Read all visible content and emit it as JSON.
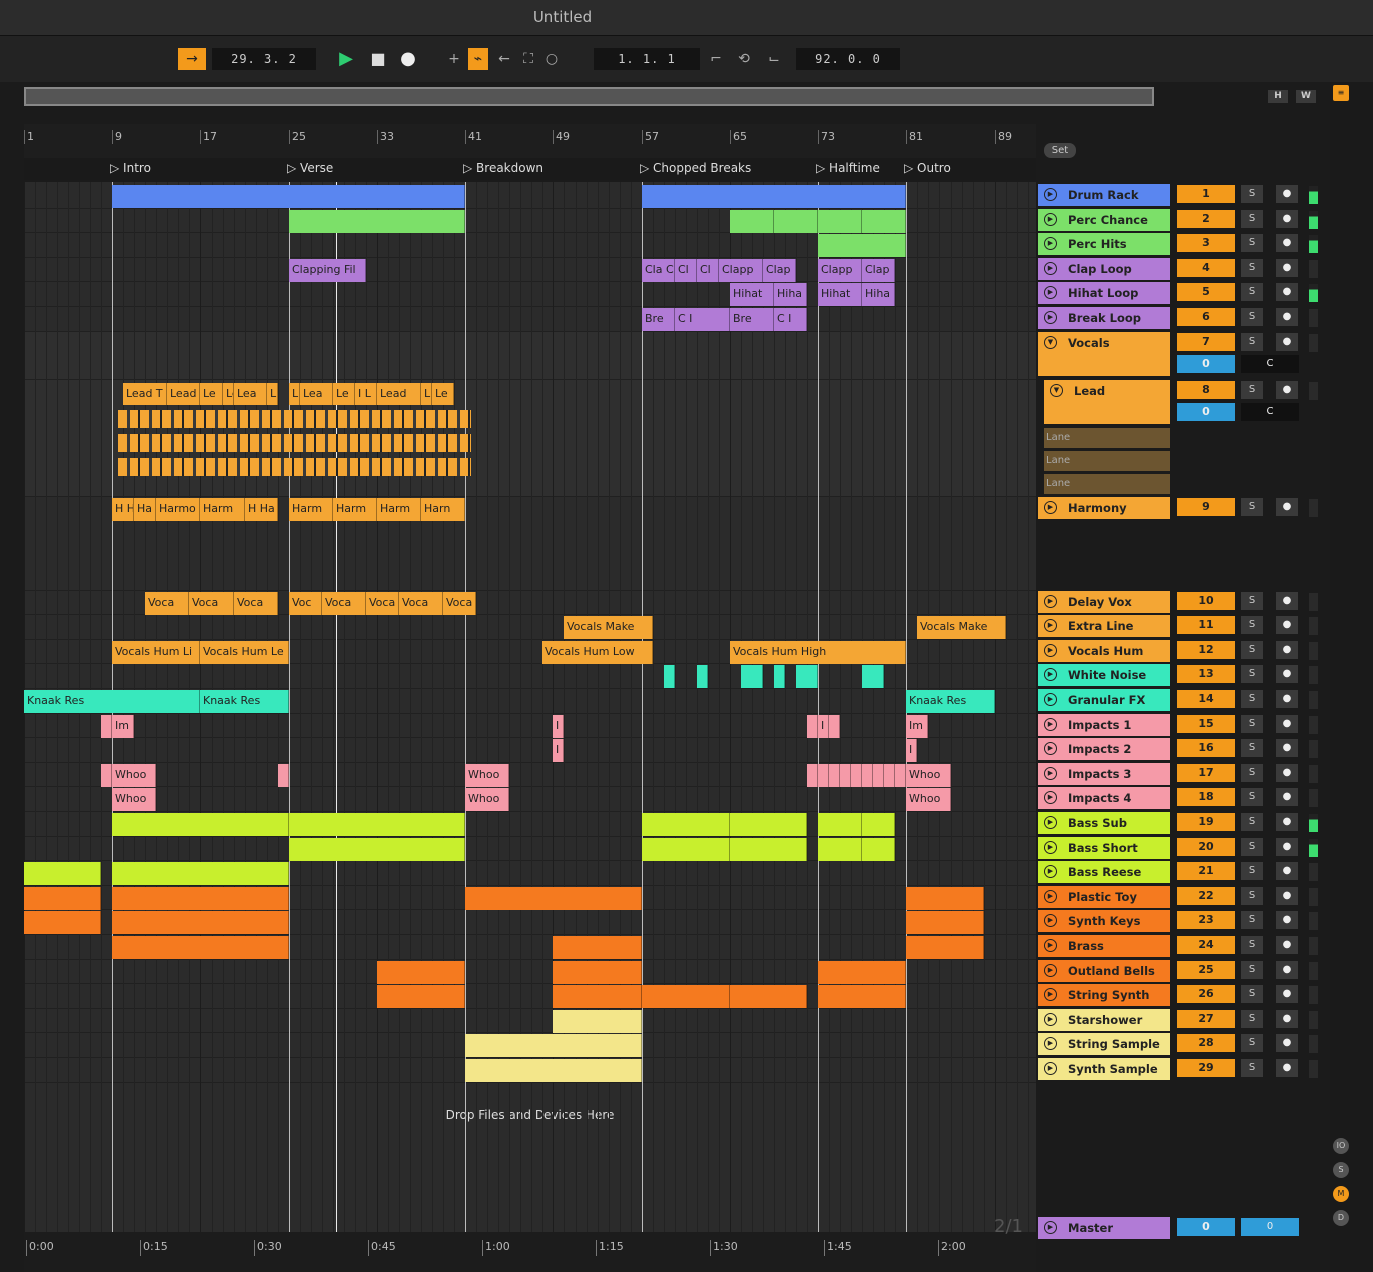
{
  "window": {
    "title": "Untitled"
  },
  "transport": {
    "position": "29.  3.  2",
    "loop_start": "1.  1.  1",
    "loop_length": "92.  0.  0"
  },
  "overview": {
    "h_label": "H",
    "w_label": "W"
  },
  "ruler": {
    "bars": [
      "1",
      "9",
      "17",
      "25",
      "33",
      "41",
      "49",
      "57",
      "65",
      "73",
      "81",
      "89"
    ]
  },
  "locators": [
    "Intro",
    "Verse",
    "Breakdown",
    "Chopped Breaks",
    "Halftime",
    "Outro"
  ],
  "set_label": "Set",
  "drop_hint": "Drop Files and Devices Here",
  "page_counter": "2/1",
  "time_ruler": [
    "0:00",
    "0:15",
    "0:30",
    "0:45",
    "1:00",
    "1:15",
    "1:30",
    "1:45",
    "2:00"
  ],
  "colors": {
    "blue": "#5a86f0",
    "green": "#7ce069",
    "purple": "#b17bd6",
    "orange": "#f4a634",
    "teal": "#38e8bd",
    "pink": "#f59aa8",
    "lime": "#c8ef2d",
    "deeporange": "#f57a1f",
    "yellow": "#f3e68a",
    "cyan": "#44d9f0"
  },
  "tracks": [
    {
      "name": "Drum Rack",
      "num": "1",
      "solo": "S",
      "color": "#5a86f0"
    },
    {
      "name": "Perc Chance",
      "num": "2",
      "solo": "S",
      "color": "#7ce069"
    },
    {
      "name": "Perc Hits",
      "num": "3",
      "solo": "S",
      "color": "#7ce069"
    },
    {
      "name": "Clap Loop",
      "num": "4",
      "solo": "S",
      "color": "#b17bd6"
    },
    {
      "name": "Hihat Loop",
      "num": "5",
      "solo": "S",
      "color": "#b17bd6"
    },
    {
      "name": "Break Loop",
      "num": "6",
      "solo": "S",
      "color": "#b17bd6"
    },
    {
      "name": "Vocals",
      "num": "7",
      "solo": "S",
      "color": "#f4a634",
      "group": true,
      "vol": "0",
      "pan": "C"
    },
    {
      "name": "Lead",
      "num": "8",
      "solo": "S",
      "color": "#f4a634",
      "group": true,
      "vol": "0",
      "pan": "C",
      "lanes": [
        "Lane",
        "Lane",
        "Lane"
      ]
    },
    {
      "name": "Harmony",
      "num": "9",
      "solo": "S",
      "color": "#f4a634"
    },
    {
      "name": "Delay Vox",
      "num": "10",
      "solo": "S",
      "color": "#f4a634"
    },
    {
      "name": "Extra Line",
      "num": "11",
      "solo": "S",
      "color": "#f4a634"
    },
    {
      "name": "Vocals Hum",
      "num": "12",
      "solo": "S",
      "color": "#f4a634"
    },
    {
      "name": "White Noise",
      "num": "13",
      "solo": "S",
      "color": "#38e8bd"
    },
    {
      "name": "Granular FX",
      "num": "14",
      "solo": "S",
      "color": "#38e8bd"
    },
    {
      "name": "Impacts 1",
      "num": "15",
      "solo": "S",
      "color": "#f59aa8"
    },
    {
      "name": "Impacts 2",
      "num": "16",
      "solo": "S",
      "color": "#f59aa8"
    },
    {
      "name": "Impacts 3",
      "num": "17",
      "solo": "S",
      "color": "#f59aa8"
    },
    {
      "name": "Impacts 4",
      "num": "18",
      "solo": "S",
      "color": "#f59aa8"
    },
    {
      "name": "Bass Sub",
      "num": "19",
      "solo": "S",
      "color": "#c8ef2d"
    },
    {
      "name": "Bass Short",
      "num": "20",
      "solo": "S",
      "color": "#c8ef2d"
    },
    {
      "name": "Bass Reese",
      "num": "21",
      "solo": "S",
      "color": "#c8ef2d"
    },
    {
      "name": "Plastic Toy",
      "num": "22",
      "solo": "S",
      "color": "#f57a1f"
    },
    {
      "name": "Synth Keys",
      "num": "23",
      "solo": "S",
      "color": "#f57a1f"
    },
    {
      "name": "Brass",
      "num": "24",
      "solo": "S",
      "color": "#f57a1f"
    },
    {
      "name": "Outland Bells",
      "num": "25",
      "solo": "S",
      "color": "#f57a1f"
    },
    {
      "name": "String Synth",
      "num": "26",
      "solo": "S",
      "color": "#f57a1f"
    },
    {
      "name": "Starshower Pad",
      "num": "27",
      "solo": "S",
      "color": "#f3e68a"
    },
    {
      "name": "String Sample",
      "num": "28",
      "solo": "S",
      "color": "#f3e68a"
    },
    {
      "name": "Synth Sample",
      "num": "29",
      "solo": "S",
      "color": "#f3e68a"
    }
  ],
  "master": {
    "name": "Master",
    "vol": "0",
    "pan": "0",
    "color": "#b17bd6"
  },
  "clips": [
    {
      "row": 0,
      "bars": [
        [
          9,
          41,
          ""
        ],
        [
          57,
          81,
          ""
        ]
      ],
      "color": "#5a86f0"
    },
    {
      "row": 1,
      "bars": [
        [
          25,
          41,
          ""
        ],
        [
          65,
          69,
          ""
        ],
        [
          69,
          73,
          ""
        ],
        [
          73,
          77,
          ""
        ],
        [
          77,
          81,
          ""
        ]
      ],
      "color": "#7ce069"
    },
    {
      "row": 2,
      "bars": [
        [
          73,
          81,
          ""
        ]
      ],
      "color": "#7ce069"
    },
    {
      "row": 3,
      "bars": [
        [
          25,
          32,
          "Clapping Fil"
        ],
        [
          57,
          60,
          "Cla C"
        ],
        [
          60,
          62,
          "Cl"
        ],
        [
          62,
          64,
          "Cl"
        ],
        [
          64,
          68,
          "Clapp"
        ],
        [
          68,
          71,
          "Clap"
        ],
        [
          73,
          77,
          "Clapp"
        ],
        [
          77,
          80,
          "Clap"
        ]
      ],
      "color": "#b17bd6"
    },
    {
      "row": 4,
      "bars": [
        [
          65,
          69,
          "Hihat"
        ],
        [
          69,
          72,
          "Hiha"
        ],
        [
          73,
          77,
          "Hihat"
        ],
        [
          77,
          80,
          "Hiha"
        ]
      ],
      "color": "#b17bd6"
    },
    {
      "row": 5,
      "bars": [
        [
          57,
          60,
          "Bre"
        ],
        [
          60,
          65,
          "C I"
        ],
        [
          65,
          69,
          "Bre"
        ],
        [
          69,
          72,
          "C I"
        ]
      ],
      "color": "#b17bd6"
    },
    {
      "row": 7,
      "bars": [
        [
          10,
          14,
          "Lead T"
        ],
        [
          14,
          17,
          "Lead T"
        ],
        [
          17,
          19,
          "Le"
        ],
        [
          19,
          20,
          "Le"
        ],
        [
          20,
          23,
          "Lea"
        ],
        [
          23,
          24,
          "L"
        ],
        [
          25,
          26,
          "L"
        ],
        [
          26,
          29,
          "Lea"
        ],
        [
          29,
          31,
          "Le"
        ],
        [
          31,
          33,
          "I L"
        ],
        [
          33,
          37,
          "Lead"
        ],
        [
          37,
          38,
          "L"
        ],
        [
          38,
          40,
          "Le"
        ]
      ],
      "color": "#f4a634"
    },
    {
      "row": 8,
      "bars": [
        [
          9,
          11,
          "H H"
        ],
        [
          11,
          13,
          "Ha"
        ],
        [
          13,
          17,
          "Harmo"
        ],
        [
          17,
          21,
          "Harm"
        ],
        [
          21,
          24,
          "H Ha"
        ],
        [
          25,
          29,
          "Harm"
        ],
        [
          29,
          33,
          "Harm"
        ],
        [
          33,
          37,
          "Harm"
        ],
        [
          37,
          41,
          "Harn"
        ]
      ],
      "color": "#f4a634"
    },
    {
      "row": 9,
      "bars": [
        [
          12,
          16,
          "Voca"
        ],
        [
          16,
          20,
          "Voca"
        ],
        [
          20,
          24,
          "Voca"
        ],
        [
          25,
          28,
          "Voc"
        ],
        [
          28,
          32,
          "Voca"
        ],
        [
          32,
          35,
          "Voca"
        ],
        [
          35,
          39,
          "Voca"
        ],
        [
          39,
          42,
          "Voca"
        ]
      ],
      "color": "#f4a634"
    },
    {
      "row": 10,
      "bars": [
        [
          50,
          58,
          "Vocals Make"
        ],
        [
          82,
          90,
          "Vocals Make"
        ]
      ],
      "color": "#f4a634"
    },
    {
      "row": 11,
      "bars": [
        [
          9,
          17,
          "Vocals Hum Li"
        ],
        [
          17,
          25,
          "Vocals Hum Le"
        ],
        [
          48,
          58,
          "Vocals Hum Low"
        ],
        [
          65,
          81,
          "Vocals Hum High"
        ]
      ],
      "color": "#f4a634"
    },
    {
      "row": 12,
      "bars": [
        [
          59,
          60,
          ""
        ],
        [
          62,
          63,
          ""
        ],
        [
          66,
          68,
          ""
        ],
        [
          69,
          70,
          ""
        ],
        [
          71,
          73,
          ""
        ],
        [
          77,
          79,
          ""
        ]
      ],
      "color": "#38e8bd"
    },
    {
      "row": 13,
      "bars": [
        [
          1,
          17,
          "Knaak Res"
        ],
        [
          17,
          25,
          "Knaak Res"
        ],
        [
          81,
          89,
          "Knaak Res"
        ]
      ],
      "color": "#38e8bd"
    },
    {
      "row": 14,
      "bars": [
        [
          8,
          9,
          ""
        ],
        [
          9,
          11,
          "Im"
        ],
        [
          49,
          50,
          "I"
        ],
        [
          72,
          73,
          ""
        ],
        [
          73,
          74,
          "I"
        ],
        [
          74,
          75,
          ""
        ],
        [
          81,
          83,
          "Im"
        ]
      ],
      "color": "#f59aa8"
    },
    {
      "row": 15,
      "bars": [
        [
          49,
          50,
          "I"
        ],
        [
          81,
          82,
          "I"
        ]
      ],
      "color": "#f59aa8"
    },
    {
      "row": 16,
      "bars": [
        [
          8,
          9,
          ""
        ],
        [
          9,
          13,
          "Whoo"
        ],
        [
          24,
          25,
          ""
        ],
        [
          41,
          45,
          "Whoo"
        ],
        [
          72,
          73,
          ""
        ],
        [
          73,
          74,
          ""
        ],
        [
          74,
          75,
          ""
        ],
        [
          75,
          76,
          ""
        ],
        [
          76,
          77,
          ""
        ],
        [
          77,
          78,
          ""
        ],
        [
          78,
          79,
          ""
        ],
        [
          79,
          80,
          ""
        ],
        [
          80,
          81,
          ""
        ],
        [
          81,
          85,
          "Whoo"
        ]
      ],
      "color": "#f59aa8"
    },
    {
      "row": 17,
      "bars": [
        [
          9,
          13,
          "Whoo"
        ],
        [
          41,
          45,
          "Whoo"
        ],
        [
          81,
          85,
          "Whoo"
        ]
      ],
      "color": "#f59aa8"
    },
    {
      "row": 18,
      "bars": [
        [
          9,
          25,
          ""
        ],
        [
          25,
          41,
          ""
        ],
        [
          57,
          65,
          ""
        ],
        [
          65,
          72,
          ""
        ],
        [
          73,
          77,
          ""
        ],
        [
          77,
          80,
          ""
        ]
      ],
      "color": "#c8ef2d"
    },
    {
      "row": 19,
      "bars": [
        [
          25,
          41,
          ""
        ],
        [
          57,
          65,
          ""
        ],
        [
          65,
          72,
          ""
        ],
        [
          73,
          77,
          ""
        ],
        [
          77,
          80,
          ""
        ]
      ],
      "color": "#c8ef2d"
    },
    {
      "row": 20,
      "bars": [
        [
          1,
          8,
          ""
        ],
        [
          9,
          25,
          ""
        ]
      ],
      "color": "#c8ef2d"
    },
    {
      "row": 21,
      "bars": [
        [
          1,
          8,
          ""
        ],
        [
          9,
          25,
          ""
        ],
        [
          41,
          57,
          ""
        ],
        [
          81,
          88,
          ""
        ]
      ],
      "color": "#f57a1f"
    },
    {
      "row": 22,
      "bars": [
        [
          1,
          8,
          ""
        ],
        [
          9,
          25,
          ""
        ],
        [
          81,
          88,
          ""
        ]
      ],
      "color": "#f57a1f"
    },
    {
      "row": 23,
      "bars": [
        [
          9,
          25,
          ""
        ],
        [
          49,
          57,
          ""
        ],
        [
          81,
          88,
          ""
        ]
      ],
      "color": "#f57a1f"
    },
    {
      "row": 24,
      "bars": [
        [
          33,
          41,
          ""
        ],
        [
          49,
          57,
          ""
        ],
        [
          73,
          81,
          ""
        ]
      ],
      "color": "#f57a1f"
    },
    {
      "row": 25,
      "bars": [
        [
          33,
          41,
          ""
        ],
        [
          49,
          57,
          ""
        ],
        [
          57,
          65,
          ""
        ],
        [
          65,
          72,
          ""
        ],
        [
          73,
          81,
          ""
        ]
      ],
      "color": "#f57a1f"
    },
    {
      "row": 26,
      "bars": [
        [
          49,
          57,
          ""
        ]
      ],
      "color": "#f3e68a"
    },
    {
      "row": 27,
      "bars": [
        [
          41,
          57,
          ""
        ]
      ],
      "color": "#f3e68a"
    },
    {
      "row": 28,
      "bars": [
        [
          41,
          57,
          ""
        ]
      ],
      "color": "#f3e68a"
    }
  ]
}
